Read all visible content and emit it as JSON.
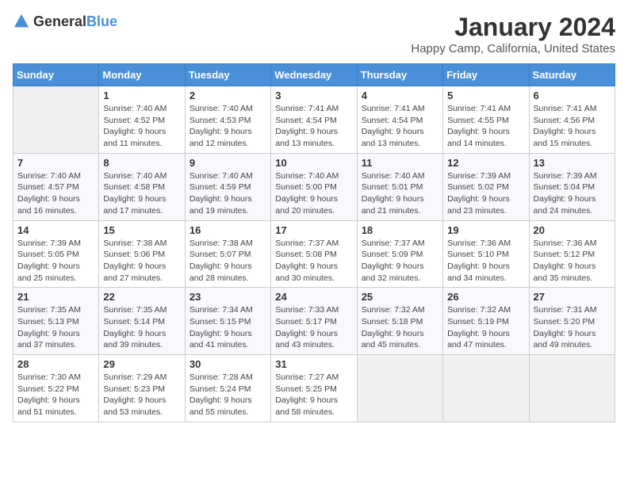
{
  "logo": {
    "general": "General",
    "blue": "Blue"
  },
  "header": {
    "title": "January 2024",
    "subtitle": "Happy Camp, California, United States"
  },
  "weekdays": [
    "Sunday",
    "Monday",
    "Tuesday",
    "Wednesday",
    "Thursday",
    "Friday",
    "Saturday"
  ],
  "weeks": [
    [
      {
        "day": null
      },
      {
        "day": "1",
        "sunrise": "Sunrise: 7:40 AM",
        "sunset": "Sunset: 4:52 PM",
        "daylight": "Daylight: 9 hours and 11 minutes."
      },
      {
        "day": "2",
        "sunrise": "Sunrise: 7:40 AM",
        "sunset": "Sunset: 4:53 PM",
        "daylight": "Daylight: 9 hours and 12 minutes."
      },
      {
        "day": "3",
        "sunrise": "Sunrise: 7:41 AM",
        "sunset": "Sunset: 4:54 PM",
        "daylight": "Daylight: 9 hours and 13 minutes."
      },
      {
        "day": "4",
        "sunrise": "Sunrise: 7:41 AM",
        "sunset": "Sunset: 4:54 PM",
        "daylight": "Daylight: 9 hours and 13 minutes."
      },
      {
        "day": "5",
        "sunrise": "Sunrise: 7:41 AM",
        "sunset": "Sunset: 4:55 PM",
        "daylight": "Daylight: 9 hours and 14 minutes."
      },
      {
        "day": "6",
        "sunrise": "Sunrise: 7:41 AM",
        "sunset": "Sunset: 4:56 PM",
        "daylight": "Daylight: 9 hours and 15 minutes."
      }
    ],
    [
      {
        "day": "7",
        "sunrise": "Sunrise: 7:40 AM",
        "sunset": "Sunset: 4:57 PM",
        "daylight": "Daylight: 9 hours and 16 minutes."
      },
      {
        "day": "8",
        "sunrise": "Sunrise: 7:40 AM",
        "sunset": "Sunset: 4:58 PM",
        "daylight": "Daylight: 9 hours and 17 minutes."
      },
      {
        "day": "9",
        "sunrise": "Sunrise: 7:40 AM",
        "sunset": "Sunset: 4:59 PM",
        "daylight": "Daylight: 9 hours and 19 minutes."
      },
      {
        "day": "10",
        "sunrise": "Sunrise: 7:40 AM",
        "sunset": "Sunset: 5:00 PM",
        "daylight": "Daylight: 9 hours and 20 minutes."
      },
      {
        "day": "11",
        "sunrise": "Sunrise: 7:40 AM",
        "sunset": "Sunset: 5:01 PM",
        "daylight": "Daylight: 9 hours and 21 minutes."
      },
      {
        "day": "12",
        "sunrise": "Sunrise: 7:39 AM",
        "sunset": "Sunset: 5:02 PM",
        "daylight": "Daylight: 9 hours and 23 minutes."
      },
      {
        "day": "13",
        "sunrise": "Sunrise: 7:39 AM",
        "sunset": "Sunset: 5:04 PM",
        "daylight": "Daylight: 9 hours and 24 minutes."
      }
    ],
    [
      {
        "day": "14",
        "sunrise": "Sunrise: 7:39 AM",
        "sunset": "Sunset: 5:05 PM",
        "daylight": "Daylight: 9 hours and 25 minutes."
      },
      {
        "day": "15",
        "sunrise": "Sunrise: 7:38 AM",
        "sunset": "Sunset: 5:06 PM",
        "daylight": "Daylight: 9 hours and 27 minutes."
      },
      {
        "day": "16",
        "sunrise": "Sunrise: 7:38 AM",
        "sunset": "Sunset: 5:07 PM",
        "daylight": "Daylight: 9 hours and 28 minutes."
      },
      {
        "day": "17",
        "sunrise": "Sunrise: 7:37 AM",
        "sunset": "Sunset: 5:08 PM",
        "daylight": "Daylight: 9 hours and 30 minutes."
      },
      {
        "day": "18",
        "sunrise": "Sunrise: 7:37 AM",
        "sunset": "Sunset: 5:09 PM",
        "daylight": "Daylight: 9 hours and 32 minutes."
      },
      {
        "day": "19",
        "sunrise": "Sunrise: 7:36 AM",
        "sunset": "Sunset: 5:10 PM",
        "daylight": "Daylight: 9 hours and 34 minutes."
      },
      {
        "day": "20",
        "sunrise": "Sunrise: 7:36 AM",
        "sunset": "Sunset: 5:12 PM",
        "daylight": "Daylight: 9 hours and 35 minutes."
      }
    ],
    [
      {
        "day": "21",
        "sunrise": "Sunrise: 7:35 AM",
        "sunset": "Sunset: 5:13 PM",
        "daylight": "Daylight: 9 hours and 37 minutes."
      },
      {
        "day": "22",
        "sunrise": "Sunrise: 7:35 AM",
        "sunset": "Sunset: 5:14 PM",
        "daylight": "Daylight: 9 hours and 39 minutes."
      },
      {
        "day": "23",
        "sunrise": "Sunrise: 7:34 AM",
        "sunset": "Sunset: 5:15 PM",
        "daylight": "Daylight: 9 hours and 41 minutes."
      },
      {
        "day": "24",
        "sunrise": "Sunrise: 7:33 AM",
        "sunset": "Sunset: 5:17 PM",
        "daylight": "Daylight: 9 hours and 43 minutes."
      },
      {
        "day": "25",
        "sunrise": "Sunrise: 7:32 AM",
        "sunset": "Sunset: 5:18 PM",
        "daylight": "Daylight: 9 hours and 45 minutes."
      },
      {
        "day": "26",
        "sunrise": "Sunrise: 7:32 AM",
        "sunset": "Sunset: 5:19 PM",
        "daylight": "Daylight: 9 hours and 47 minutes."
      },
      {
        "day": "27",
        "sunrise": "Sunrise: 7:31 AM",
        "sunset": "Sunset: 5:20 PM",
        "daylight": "Daylight: 9 hours and 49 minutes."
      }
    ],
    [
      {
        "day": "28",
        "sunrise": "Sunrise: 7:30 AM",
        "sunset": "Sunset: 5:22 PM",
        "daylight": "Daylight: 9 hours and 51 minutes."
      },
      {
        "day": "29",
        "sunrise": "Sunrise: 7:29 AM",
        "sunset": "Sunset: 5:23 PM",
        "daylight": "Daylight: 9 hours and 53 minutes."
      },
      {
        "day": "30",
        "sunrise": "Sunrise: 7:28 AM",
        "sunset": "Sunset: 5:24 PM",
        "daylight": "Daylight: 9 hours and 55 minutes."
      },
      {
        "day": "31",
        "sunrise": "Sunrise: 7:27 AM",
        "sunset": "Sunset: 5:25 PM",
        "daylight": "Daylight: 9 hours and 58 minutes."
      },
      {
        "day": null
      },
      {
        "day": null
      },
      {
        "day": null
      }
    ]
  ]
}
